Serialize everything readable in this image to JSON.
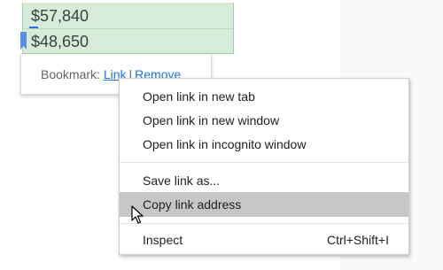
{
  "sheet": {
    "cells": [
      "$57,840",
      "$48,650"
    ]
  },
  "bookmark_popup": {
    "label": "Bookmark:",
    "link_label": "Link",
    "separator": "|",
    "remove_label": "Remove"
  },
  "context_menu": {
    "items": [
      {
        "label": "Open link in new tab"
      },
      {
        "label": "Open link in new window"
      },
      {
        "label": "Open link in incognito window"
      },
      {
        "label": "Save link as..."
      },
      {
        "label": "Copy link address",
        "highlighted": true
      },
      {
        "label": "Inspect",
        "shortcut": "Ctrl+Shift+I"
      }
    ]
  },
  "colors": {
    "cell_fill": "#d6ecd9",
    "link": "#1a73e8",
    "highlight": "#c6c6c6",
    "bookmark_flag": "#5b8ee6"
  }
}
